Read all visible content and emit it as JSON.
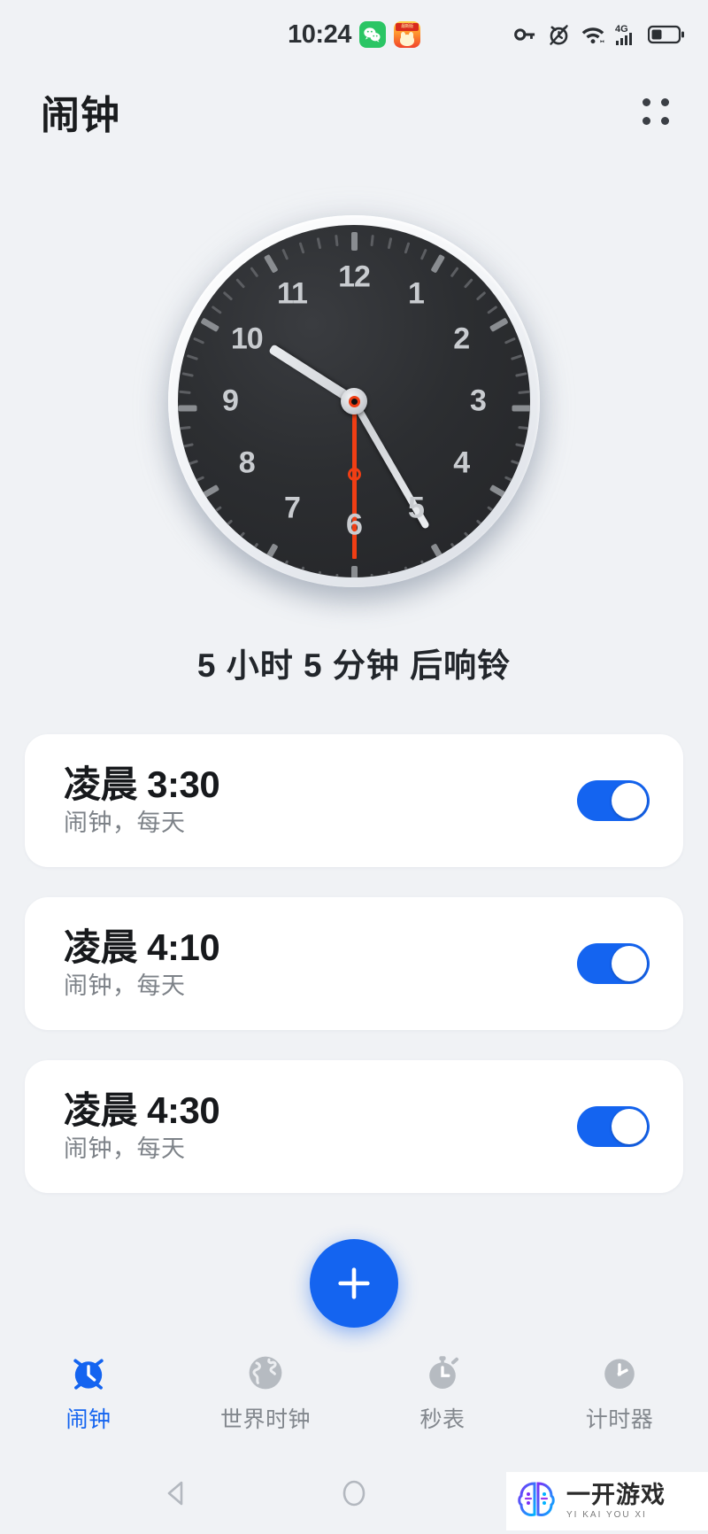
{
  "status_bar": {
    "time": "10:24",
    "icons": [
      "wechat-badge",
      "red-packet-badge",
      "vpn-key-icon",
      "alarm-set-icon",
      "wifi-icon",
      "network-4g-icon",
      "signal-bars-icon",
      "battery-icon"
    ],
    "network_label": "4G"
  },
  "header": {
    "title": "闹钟",
    "menu_icon": "grid-menu-icon"
  },
  "clock": {
    "hour": 10,
    "minute": 25,
    "second": 30,
    "hour_angle": 302.5,
    "minute_angle": 150,
    "second_angle": 180,
    "numerals": [
      "12",
      "1",
      "2",
      "3",
      "4",
      "5",
      "6",
      "7",
      "8",
      "9",
      "10",
      "11"
    ],
    "face_color": "#2c2e31",
    "second_hand_color": "#f03e14",
    "hand_color": "#d8dbdf"
  },
  "ring_in": {
    "text": "5 小时 5 分钟 后响铃"
  },
  "alarms": [
    {
      "period": "凌晨",
      "time": "3:30",
      "subtitle": "闹钟，每天",
      "enabled": true
    },
    {
      "period": "凌晨",
      "time": "4:10",
      "subtitle": "闹钟，每天",
      "enabled": true
    },
    {
      "period": "凌晨",
      "time": "4:30",
      "subtitle": "闹钟，每天",
      "enabled": true
    }
  ],
  "fab": {
    "icon": "plus-icon",
    "color": "#1464f0"
  },
  "tabs": [
    {
      "label": "闹钟",
      "icon": "alarm-clock-icon",
      "active": true
    },
    {
      "label": "世界时钟",
      "icon": "globe-icon",
      "active": false
    },
    {
      "label": "秒表",
      "icon": "stopwatch-icon",
      "active": false
    },
    {
      "label": "计时器",
      "icon": "timer-icon",
      "active": false
    }
  ],
  "system_nav": {
    "back": "back-triangle-icon",
    "home": "home-circle-icon",
    "recents": "recents-square-icon"
  },
  "watermark": {
    "cn": "一开游戏",
    "en": "YI KAI YOU XI"
  },
  "theme": {
    "accent": "#1464f0",
    "background": "#f0f2f5",
    "card": "#ffffff"
  }
}
